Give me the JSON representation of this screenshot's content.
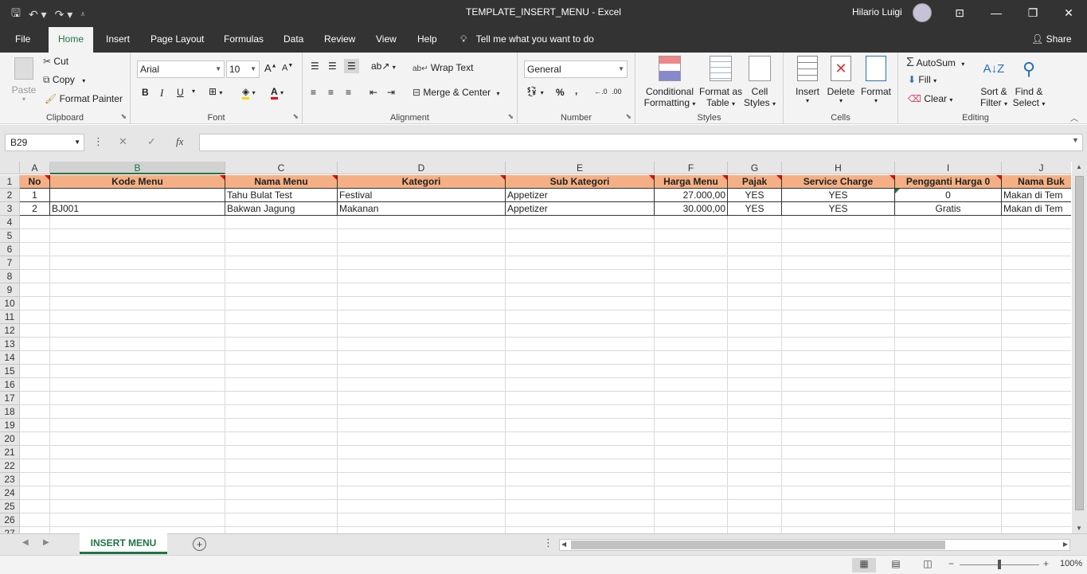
{
  "window": {
    "title": "TEMPLATE_INSERT_MENU  -  Excel",
    "user": "Hilario Luigi",
    "minimize": "—",
    "restore": "❐",
    "close": "✕",
    "ribbon_display": "⊡"
  },
  "tabs": [
    "File",
    "Home",
    "Insert",
    "Page Layout",
    "Formulas",
    "Data",
    "Review",
    "View",
    "Help"
  ],
  "active_tab": "Home",
  "tell_me": "Tell me what you want to do",
  "share": "Share",
  "ribbon": {
    "clipboard": {
      "label": "Clipboard",
      "paste": "Paste",
      "cut": "Cut",
      "copy": "Copy",
      "format_painter": "Format Painter"
    },
    "font": {
      "label": "Font",
      "name": "Arial",
      "size": "10",
      "bold": "B",
      "italic": "I",
      "underline": "U"
    },
    "alignment": {
      "label": "Alignment",
      "wrap_text": "Wrap Text",
      "merge_center": "Merge & Center"
    },
    "number": {
      "label": "Number",
      "format": "General",
      "percent": "%",
      "comma": ","
    },
    "styles": {
      "label": "Styles",
      "conditional": "Conditional",
      "conditional2": "Formatting",
      "format_as": "Format as",
      "format_as2": "Table",
      "cell": "Cell",
      "cell2": "Styles"
    },
    "cells": {
      "label": "Cells",
      "insert": "Insert",
      "delete": "Delete",
      "format": "Format"
    },
    "editing": {
      "label": "Editing",
      "autosum": "AutoSum",
      "fill": "Fill",
      "clear": "Clear",
      "sort": "Sort &",
      "sort2": "Filter",
      "find": "Find &",
      "find2": "Select"
    }
  },
  "name_box": "B29",
  "formula": "",
  "columns": [
    "A",
    "B",
    "C",
    "D",
    "E",
    "F",
    "G",
    "H",
    "I",
    "J"
  ],
  "selected_column": "B",
  "rows": [
    "1",
    "2",
    "3",
    "4",
    "5",
    "6",
    "7",
    "8",
    "9",
    "10",
    "11",
    "12",
    "13",
    "14",
    "15",
    "16",
    "17",
    "18",
    "19",
    "20",
    "21",
    "22",
    "23",
    "24",
    "25",
    "26",
    "27"
  ],
  "header_row": [
    "No",
    "Kode Menu",
    "Nama Menu",
    "Kategori",
    "Sub Kategori",
    "Harga Menu",
    "Pajak",
    "Service Charge",
    "Pengganti Harga 0",
    "Nama Buk"
  ],
  "data_rows": [
    [
      "1",
      "",
      "Tahu Bulat Test",
      "Festival",
      "Appetizer",
      "27.000,00",
      "YES",
      "YES",
      "0",
      "Makan di Tem"
    ],
    [
      "2",
      "BJ001",
      "Bakwan Jagung",
      "Makanan",
      "Appetizer",
      "30.000,00",
      "YES",
      "YES",
      "Gratis",
      "Makan di Tem"
    ]
  ],
  "sheet_tab": "INSERT MENU",
  "zoom": "100%",
  "colors": {
    "accent": "#217346",
    "header_fill": "#f4b084",
    "comment": "#e00000"
  }
}
